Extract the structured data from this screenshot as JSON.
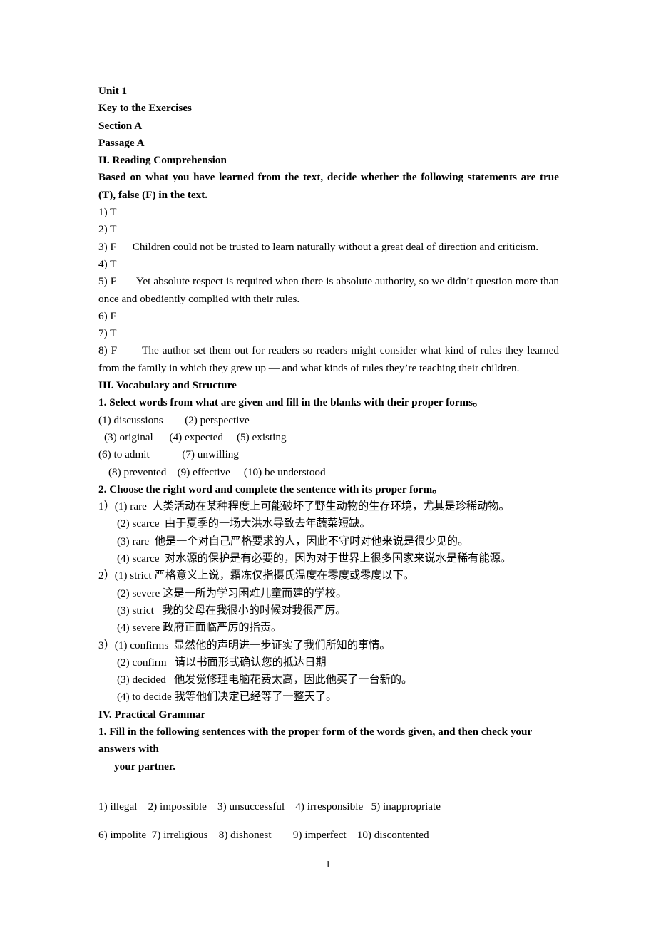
{
  "document": {
    "page_number": "1",
    "headings": {
      "unit": "Unit 1",
      "key_to_exercises": "Key to the Exercises",
      "section": "Section A",
      "passage": "Passage A",
      "part_ii": "II. Reading Comprehension",
      "part_ii_instruction": "Based on what you have learned from the text, decide whether the following statements are true (T), false (F) in the text.",
      "part_iii": "III. Vocabulary and Structure",
      "part_iii_q1": "1. Select words from what are given and fill in the blanks with their proper forms。",
      "part_iii_q2": "2. Choose the right word and complete the sentence with its proper form。",
      "part_iv": "IV. Practical Grammar",
      "part_iv_q1": "1. Fill in the following sentences with the proper form of the words given, and then check your answers with",
      "part_iv_q1_cont": "your partner."
    },
    "reading_comprehension": {
      "answers": [
        {
          "label": "1) T",
          "text": ""
        },
        {
          "label": "2) T",
          "text": ""
        },
        {
          "label": "3) F",
          "text": "Children could not be trusted to learn naturally without a great deal of direction and criticism."
        },
        {
          "label": "4) T",
          "text": ""
        },
        {
          "label": "5) F",
          "text": "Yet absolute respect is required when there is absolute authority, so we didn’t question more than once and obediently complied with their rules."
        },
        {
          "label": "6) F",
          "text": ""
        },
        {
          "label": "7) T",
          "text": ""
        },
        {
          "label": "8) F",
          "text": "The author set them out for readers so readers might consider what kind of rules they learned from the family in which they grew up — and what kinds of rules they’re teaching their children."
        }
      ]
    },
    "vocabulary_fill_in": {
      "lines": [
        "(1) discussions        (2) perspective",
        "(3) original      (4) expected     (5) existing",
        "(6) to admit            (7) unwilling",
        "(8) prevented    (9) effective     (10) be understood"
      ]
    },
    "word_choice": {
      "groups": [
        {
          "number": "1）",
          "items": [
            "(1) rare  人类活动在某种程度上可能破坏了野生动物的生存环境，尤其是珍稀动物。",
            "(2) scarce  由于夏季的一场大洪水导致去年蔬菜短缺。",
            "(3) rare  他是一个对自己严格要求的人，因此不守时对他来说是很少见的。",
            "(4) scarce  对水源的保护是有必要的，因为对于世界上很多国家来说水是稀有能源。"
          ]
        },
        {
          "number": "2）",
          "items": [
            "(1) strict 严格意义上说，霜冻仅指摄氏温度在零度或零度以下。",
            "(2) severe 这是一所为学习困难儿童而建的学校。",
            "(3) strict   我的父母在我很小的时候对我很严厉。",
            "(4) severe 政府正面临严厉的指责。"
          ]
        },
        {
          "number": "3）",
          "items": [
            "(1) confirms  显然他的声明进一步证实了我们所知的事情。",
            "(2) confirm   请以书面形式确认您的抵达日期",
            "(3) decided   他发觉修理电脑花费太高，因此他买了一台新的。",
            "(4) to decide 我等他们决定已经等了一整天了。"
          ]
        }
      ]
    },
    "practical_grammar": {
      "answer_lines": [
        "1) illegal    2) impossible    3) unsuccessful    4) irresponsible   5) inappropriate",
        "6) impolite  7) irreligious    8) dishonest        9) imperfect    10) discontented"
      ]
    }
  }
}
